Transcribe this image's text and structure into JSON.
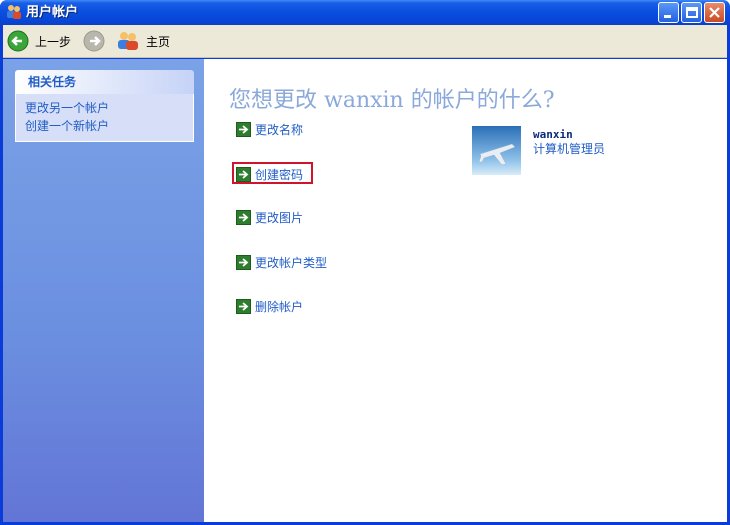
{
  "window": {
    "title": "用户帐户"
  },
  "toolbar": {
    "back_label": "上一步",
    "home_label": "主页"
  },
  "sidebar": {
    "section_title": "相关任务",
    "links": [
      "更改另一个帐户",
      "创建一个新帐户"
    ]
  },
  "main": {
    "title": "您想更改 wanxin 的帐户的什么?",
    "actions": [
      "更改名称",
      "创建密码",
      "更改图片",
      "更改帐户类型",
      "删除帐户"
    ],
    "highlighted_action": "创建密码"
  },
  "account": {
    "name": "wanxin",
    "role": "计算机管理员"
  },
  "colors": {
    "titlebar": "#0a4fe0",
    "link": "#215dc6",
    "highlight_border": "#d0142c",
    "action_arrow": "#2e7d2e"
  },
  "icons": {
    "title": "users-icon",
    "back": "back-arrow-icon",
    "forward": "forward-arrow-icon",
    "home": "users-home-icon",
    "action": "green-arrow-icon",
    "avatar": "airplane-picture"
  }
}
